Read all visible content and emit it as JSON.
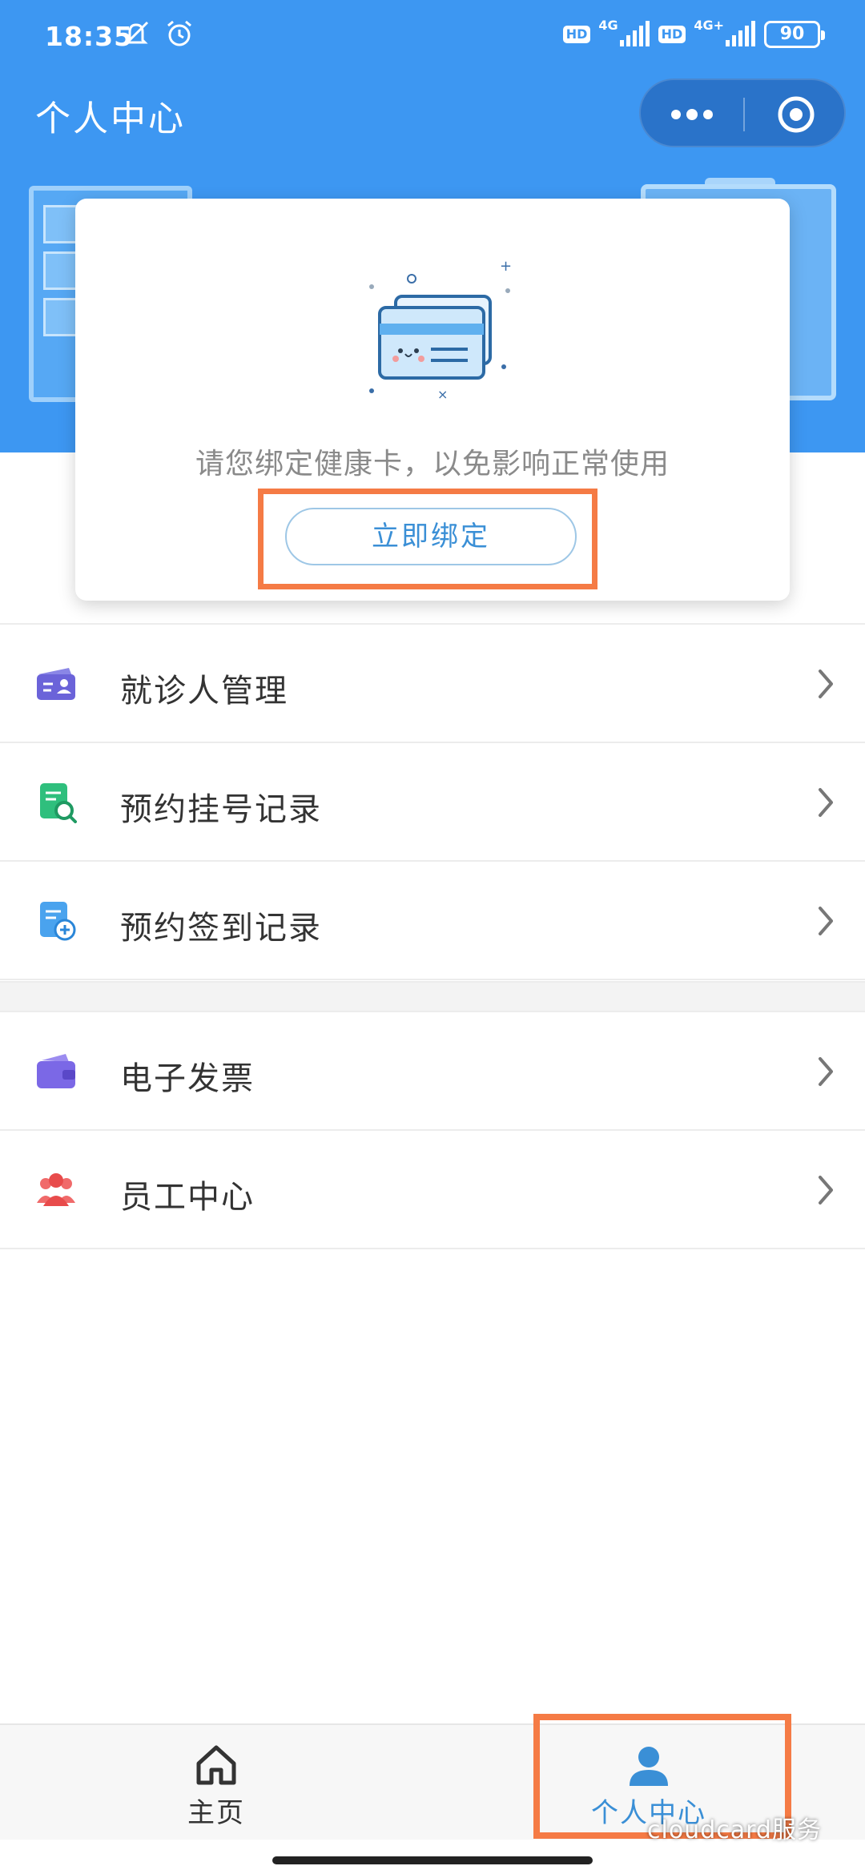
{
  "status_bar": {
    "time": "18:35",
    "hd_badge": "HD",
    "network_1": "4G",
    "network_2": "4G+",
    "battery": "90"
  },
  "nav": {
    "title": "个人中心"
  },
  "bind_card": {
    "message": "请您绑定健康卡，以免影响正常使用",
    "button_label": "立即绑定"
  },
  "menu": {
    "group1": [
      {
        "label": "就诊人管理",
        "icon": "patient-card-icon"
      },
      {
        "label": "预约挂号记录",
        "icon": "registration-search-icon"
      },
      {
        "label": "预约签到记录",
        "icon": "checkin-add-icon"
      }
    ],
    "group2": [
      {
        "label": "电子发票",
        "icon": "wallet-icon"
      },
      {
        "label": "员工中心",
        "icon": "staff-group-icon"
      }
    ]
  },
  "tab_bar": {
    "tabs": [
      {
        "label": "主页",
        "icon": "home-icon",
        "active": false
      },
      {
        "label": "个人中心",
        "icon": "person-icon",
        "active": true
      }
    ]
  },
  "watermark": "cloudcard服务",
  "colors": {
    "primary": "#3d97f2",
    "highlight": "#f57b45",
    "active_tab": "#3a8fd6"
  }
}
